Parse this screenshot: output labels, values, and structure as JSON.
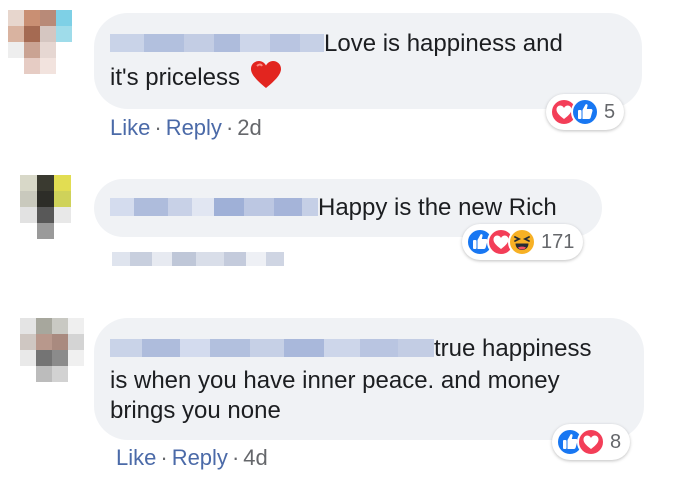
{
  "comments": [
    {
      "text_line1": "Love is happiness and",
      "text_line2": "it's priceless",
      "emoji": "heart-emoji",
      "reactions": [
        "love",
        "like"
      ],
      "reaction_count": "5",
      "actions": {
        "like": "Like",
        "reply": "Reply",
        "time": "2d",
        "separator": "·"
      }
    },
    {
      "text_line1": "Happy is the new Rich",
      "reactions": [
        "like",
        "love",
        "haha"
      ],
      "reaction_count": "171"
    },
    {
      "text_line1": "true happiness",
      "text_line2": "is when you have inner peace. and money",
      "text_line3": "brings you none",
      "reactions": [
        "like",
        "love"
      ],
      "reaction_count": "8",
      "actions": {
        "like": "Like",
        "reply": "Reply",
        "time": "4d",
        "separator": "·"
      }
    }
  ],
  "colors": {
    "bubble": "#f0f2f5",
    "link": "#4b6aa8",
    "like_blue": "#1877f2",
    "love_red": "#f33e58",
    "haha_yellow": "#f7b125"
  }
}
